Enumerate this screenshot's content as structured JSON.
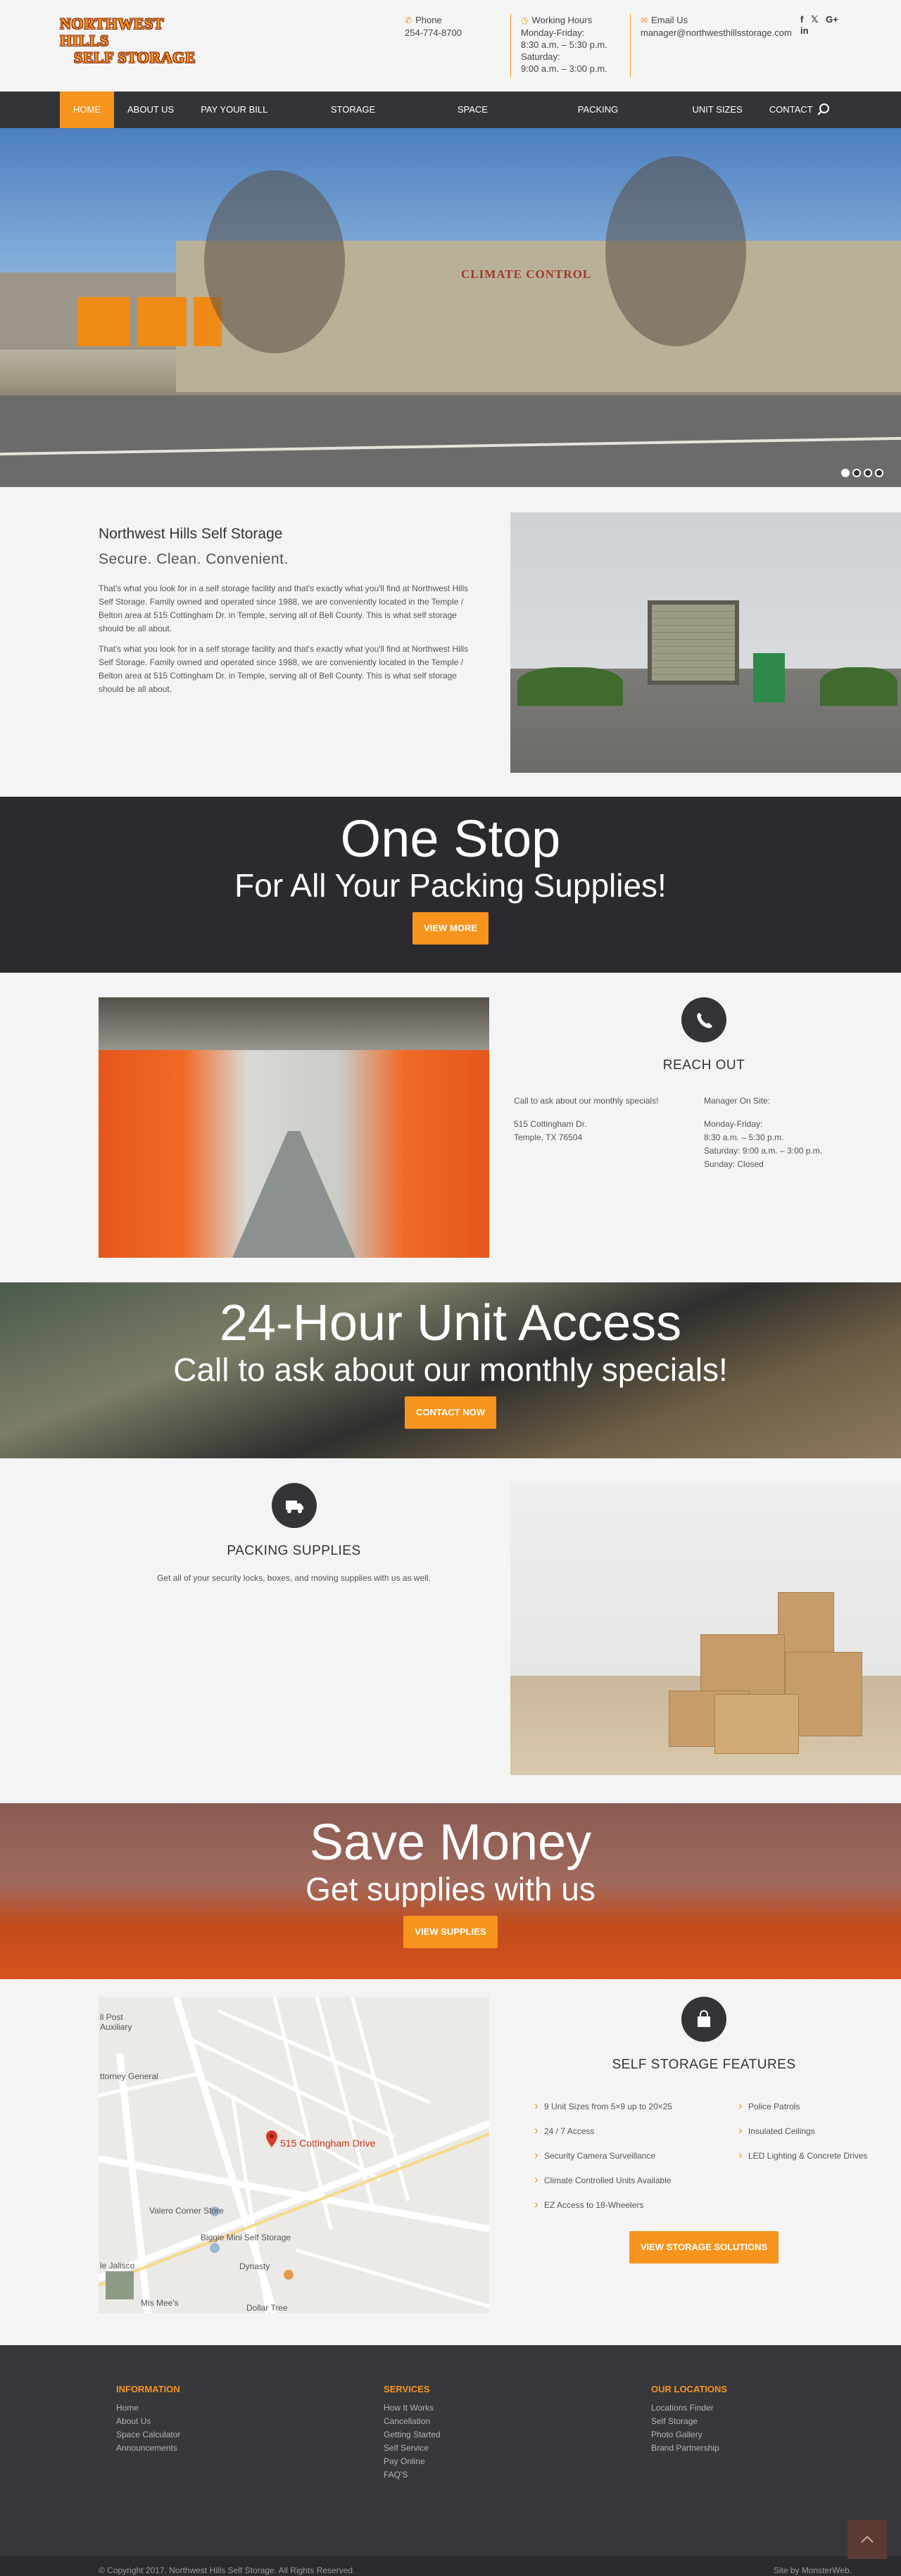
{
  "logo": {
    "line1": "NORTHWEST HILLS",
    "line2": "SELF STORAGE"
  },
  "topbar": {
    "phone_label": "Phone",
    "phone": "254-774-8700",
    "hours_label": "Working Hours",
    "hours": [
      "Monday-Friday:",
      "8:30 a.m. – 5:30 p.m.",
      "Saturday:",
      "9:00 a.m. – 3:00 p.m."
    ],
    "email_label": "Email Us",
    "email": "manager@northwesthillsstorage.com",
    "social": [
      "f",
      "𝕏",
      "G+",
      "in"
    ]
  },
  "nav": {
    "items": [
      "HOME",
      "ABOUT US",
      "PAY YOUR BILL ONLINE",
      "STORAGE SOLUTIONS",
      "SPACE CALCULATOR",
      "PACKING SUPPLIES",
      "UNIT SIZES",
      "CONTACT US"
    ],
    "active_index": 0
  },
  "hero": {
    "sign": "CLIMATE CONTROL",
    "slides": 4,
    "active_slide": 0
  },
  "about": {
    "title": "Northwest Hills Self Storage",
    "tagline": "Secure. Clean. Convenient.",
    "p1": "That's what you look for in a self storage facility and that's exactly what you'll find at Northwest Hills Self Storage. Family owned and operated since 1988, we are conveniently located in the Temple / Belton area at 515 Cottingham Dr. in Temple, serving all of Bell County. This is what self storage should be all about.",
    "p2": "That's what you look for in a self storage facility and that's exactly what you'll find at Northwest Hills Self Storage. Family owned and operated since 1988, we are conveniently located in the Temple / Belton area at 515 Cottingham Dr. in Temple, serving all of Bell County. This is what self storage should be all about."
  },
  "banner1": {
    "title": "One Stop",
    "subtitle": "For All Your Packing Supplies!",
    "button": "VIEW MORE"
  },
  "reach": {
    "title": "REACH OUT",
    "call": "Call to ask about our monthly specials!",
    "address1": "515 Cottingham Dr.",
    "address2": "Temple, TX 76504",
    "manager": "Manager On Site:",
    "hours": [
      "Monday-Friday:",
      "8:30 a.m. – 5:30 p.m.",
      "Saturday: 9:00 a.m. – 3:00 p.m.",
      "Sunday: Closed"
    ]
  },
  "banner2": {
    "title": "24-Hour Unit Access",
    "subtitle": "Call to ask about our monthly specials!",
    "button": "CONTACT NOW"
  },
  "packing": {
    "title": "PACKING SUPPLIES",
    "text": "Get all of your security locks, boxes, and moving supplies with us as well."
  },
  "banner3": {
    "title": "Save Money",
    "subtitle": "Get supplies with us",
    "button": "VIEW SUPPLIES"
  },
  "features": {
    "title": "SELF STORAGE FEATURES",
    "col1": [
      "9 Unit Sizes from 5×9 up to 20×25",
      "24 / 7 Access",
      "Security Camera Surveillance",
      "Climate Controlled Units Available",
      "EZ Access to 18-Wheelers"
    ],
    "col2": [
      "Police Patrols",
      "Insulated Ceilings",
      "LED Lighting & Concrete Drives"
    ],
    "button": "VIEW STORAGE SOLUTIONS"
  },
  "map": {
    "pin_label": "515 Cottingham Drive",
    "labels": [
      "ll Post",
      "Auxiliary",
      "ttorney General",
      "Valero Corner Store",
      "Biggie Mini Self Storage",
      "Dynasty",
      "Dollar Tree",
      "Mis Mee's",
      "le Jalisco"
    ]
  },
  "footer": {
    "information": {
      "title": "INFORMATION",
      "items": [
        "Home",
        "About Us",
        "Space Calculator",
        "Announcements"
      ]
    },
    "services": {
      "title": "SERVICES",
      "items": [
        "How It Works",
        "Cancellation",
        "Getting Started",
        "Self Service",
        "Pay Online",
        "FAQ'S"
      ]
    },
    "locations": {
      "title": "OUR LOCATIONS",
      "items": [
        "Locations Finder",
        "Self Storage",
        "Photo Gallery",
        "Brand Partnership"
      ]
    },
    "copyright": "© Copyright 2017. Northwest Hills Self Storage. All Rights Reserved.",
    "credit": "Site by MonsterWeb."
  },
  "colors": {
    "accent": "#f7941d",
    "dark": "#333438",
    "footer": "#37383c"
  }
}
